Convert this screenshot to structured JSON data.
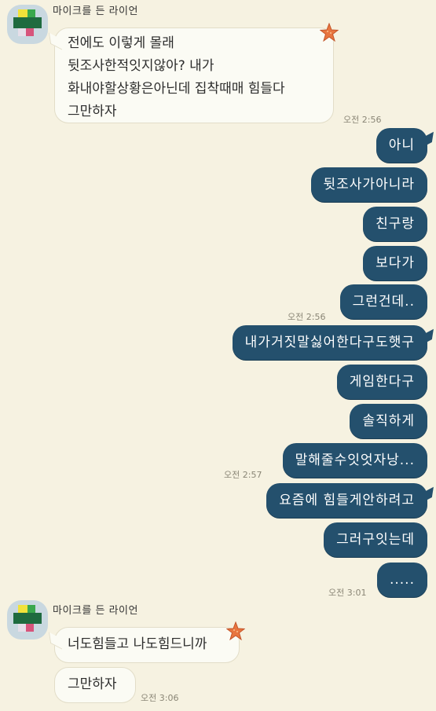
{
  "chat": {
    "groups": [
      {
        "sender": "마이크를 든 라이언",
        "messages": [
          {
            "lines": [
              "전에도 이렇게 몰래",
              "뒷조사한적잇지않아? 내가",
              "화내야할상황은아닌데 집착때매 힘들다",
              "그만하자"
            ]
          }
        ],
        "time": "오전 2:56"
      },
      {
        "mine": true,
        "messages": [
          "아니",
          "뒷조사가아니라",
          "친구랑",
          "보다가",
          "그런건데.."
        ],
        "time": "오전 2:56"
      },
      {
        "mine": true,
        "messages": [
          "내가거짓말싫어한다구도햇구",
          "게임한다구",
          "솔직하게",
          "말해줄수잇엇자낭..."
        ],
        "time": "오전 2:57"
      },
      {
        "mine": true,
        "messages": [
          "요즘에 힘들게안하려고",
          "그러구잇는데",
          "....."
        ],
        "time": "오전 3:01"
      },
      {
        "sender": "마이크를 든 라이언",
        "messages": [
          "너도힘들고 나도힘드니까",
          "그만하자"
        ],
        "time": "오전 3:06"
      }
    ]
  },
  "icons": {
    "reaction": "starfish-icon",
    "avatar": "pixelated-profile-avatar"
  },
  "colors": {
    "background": "#f6f2e1",
    "outgoing_bubble": "#24506d",
    "incoming_bubble": "#fbfbf4"
  }
}
